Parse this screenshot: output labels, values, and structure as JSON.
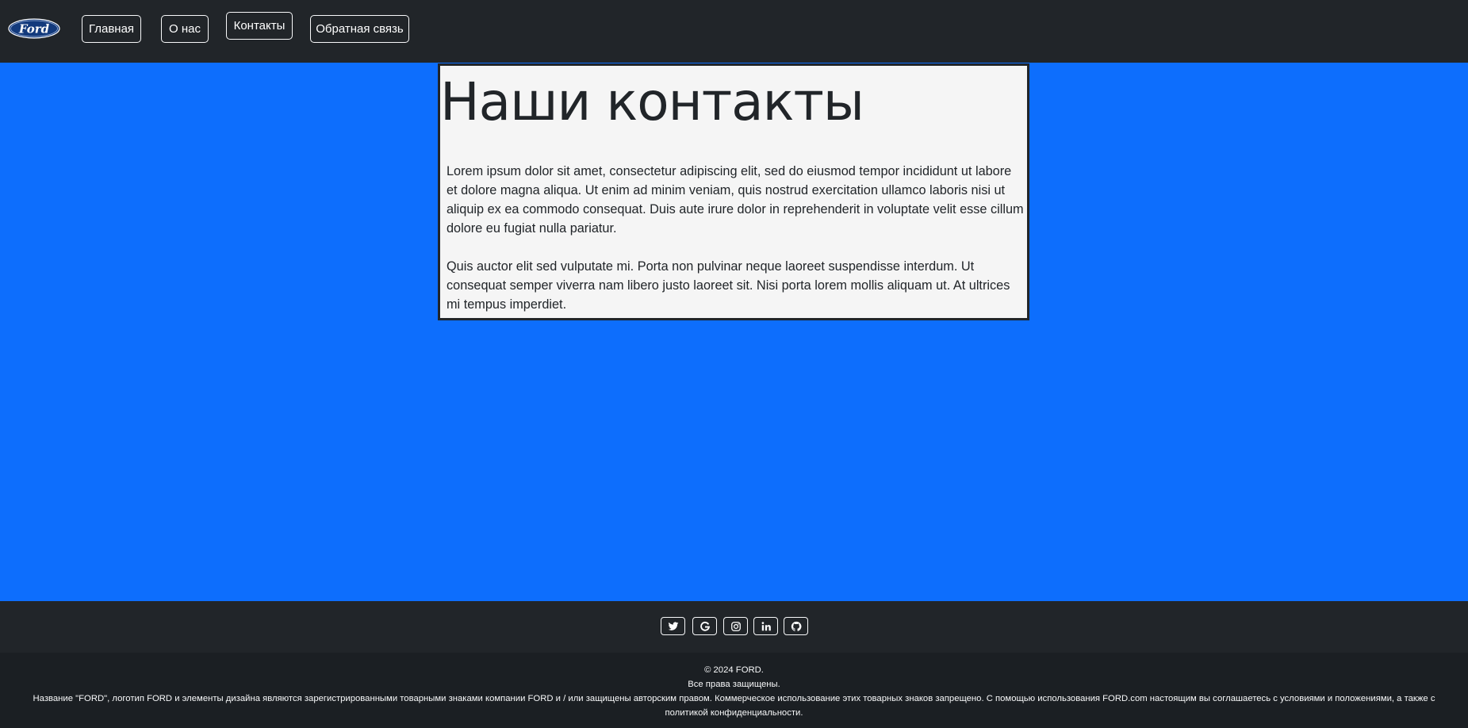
{
  "nav": {
    "logo_text": "Ford",
    "links": [
      {
        "label": "Главная"
      },
      {
        "label": "О нас"
      },
      {
        "label": "Контакты"
      },
      {
        "label": "Обратная связь"
      }
    ]
  },
  "main": {
    "title": "Наши контакты",
    "paragraphs": [
      "Lorem ipsum dolor sit amet, consectetur adipiscing elit, sed do eiusmod tempor incididunt ut labore et dolore magna aliqua. Ut enim ad minim veniam, quis nostrud exercitation ullamco laboris nisi ut aliquip ex ea commodo consequat. Duis aute irure dolor in reprehenderit in voluptate velit esse cillum dolore eu fugiat nulla pariatur.",
      "Quis auctor elit sed vulputate mi. Porta non pulvinar neque laoreet suspendisse interdum. Ut consequat semper viverra nam libero justo laoreet sit. Nisi porta lorem mollis aliquam ut. At ultrices mi tempus imperdiet."
    ]
  },
  "social": {
    "icons": [
      "twitter-icon",
      "google-icon",
      "instagram-icon",
      "linkedin-icon",
      "github-icon"
    ]
  },
  "footer": {
    "copyright": "© 2024 FORD.",
    "rights": "Все права защищены.",
    "legal": "Название \"FORD\", логотип FORD и элементы дизайна являются зарегистрированными товарными знаками компании FORD и / или защищены авторским правом. Коммерческое использование этих товарных знаков запрещено. С помощью использования FORD.com настоящим вы соглашаетесь с условиями и положениями, а также с политикой конфиденциальности."
  },
  "colors": {
    "navbar_bg": "#212529",
    "page_bg": "#0d6efd",
    "card_bg": "#f5f5f5",
    "footer_bg": "#1b1f23",
    "logo_blue": "#133a7c"
  }
}
